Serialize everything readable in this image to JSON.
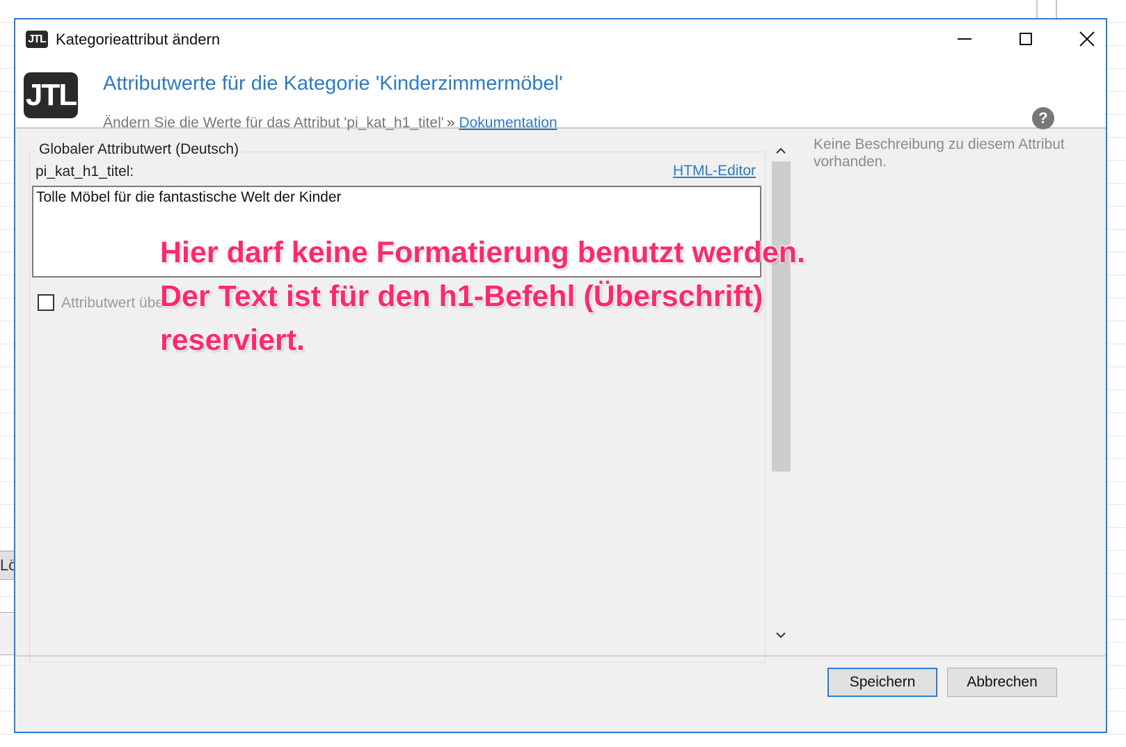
{
  "background": {
    "button_fragment": "Lö"
  },
  "window": {
    "title": "Kategorieattribut ändern",
    "logo_text": "JTL"
  },
  "header": {
    "logo_text": "JTL",
    "title": "Attributwerte für die Kategorie 'Kinderzimmermöbel'",
    "subtitle": "Ändern Sie die Werte für das Attribut 'pi_kat_h1_titel'",
    "separator": "»",
    "doc_link": "Dokumentation"
  },
  "content": {
    "group_title": "Globaler Attributwert (Deutsch)",
    "field_label": "pi_kat_h1_titel:",
    "html_editor_label": "HTML-Editor",
    "field_value": "Tolle Möbel für die fantastische Welt der Kinder",
    "checkbox_label": "Attributwert übe",
    "checkbox_checked": false
  },
  "sidebar": {
    "description": "Keine Beschreibung zu diesem Attribut vorhanden."
  },
  "footer": {
    "save_label": "Speichern",
    "cancel_label": "Abbrechen"
  },
  "annotation": {
    "line1": "Hier darf keine Formatierung benutzt werden.",
    "line2": "Der Text ist für den h1-Befehl (Überschrift)",
    "line3": "reserviert."
  },
  "colors": {
    "accent": "#2b7bd4",
    "link": "#2f79c4",
    "annotation": "#fb2a6a"
  }
}
